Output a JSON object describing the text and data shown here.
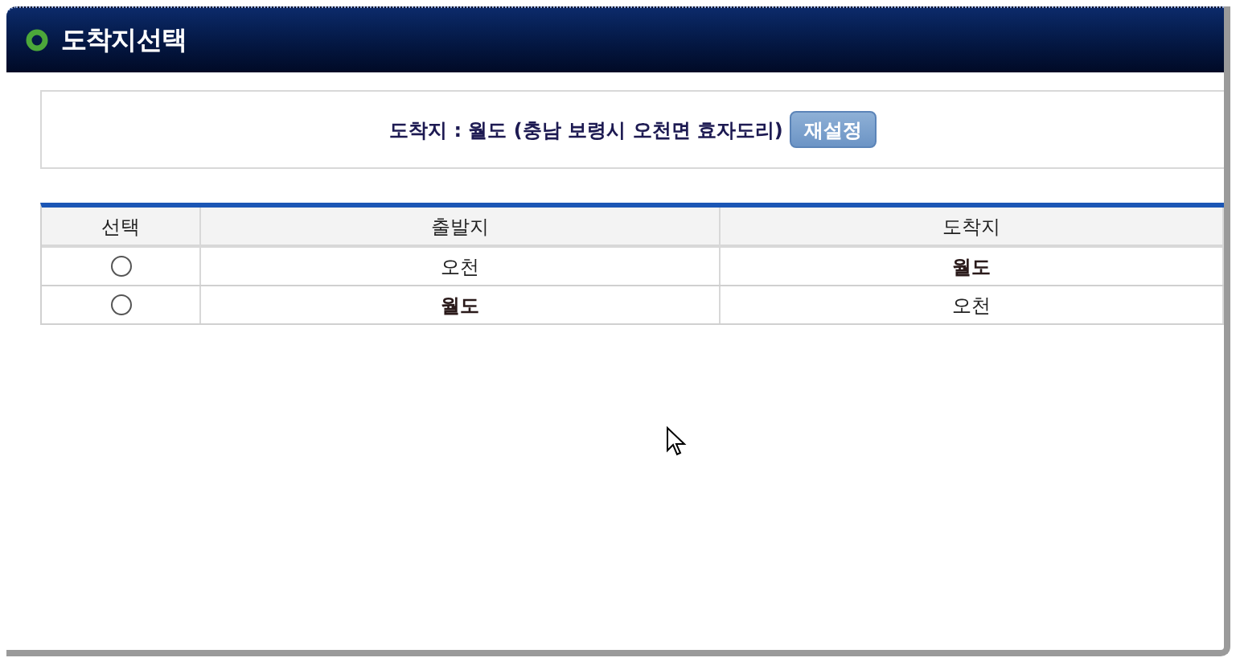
{
  "window": {
    "title": "도착지선택"
  },
  "destination": {
    "text": "도착지 : 월도 (충남 보령시 오천면 효자도리)",
    "button": "재설정"
  },
  "table": {
    "columns": [
      "선택",
      "출발지",
      "도착지"
    ],
    "rows": [
      {
        "cells": [
          {
            "kind": "radio",
            "selected": false
          },
          {
            "kind": "text",
            "text": "오천",
            "bold": false
          },
          {
            "kind": "text",
            "text": "월도",
            "bold": true
          }
        ]
      },
      {
        "cells": [
          {
            "kind": "radio",
            "selected": false
          },
          {
            "kind": "text",
            "text": "월도",
            "bold": true
          },
          {
            "kind": "text",
            "text": "오천",
            "bold": false
          }
        ]
      }
    ]
  }
}
